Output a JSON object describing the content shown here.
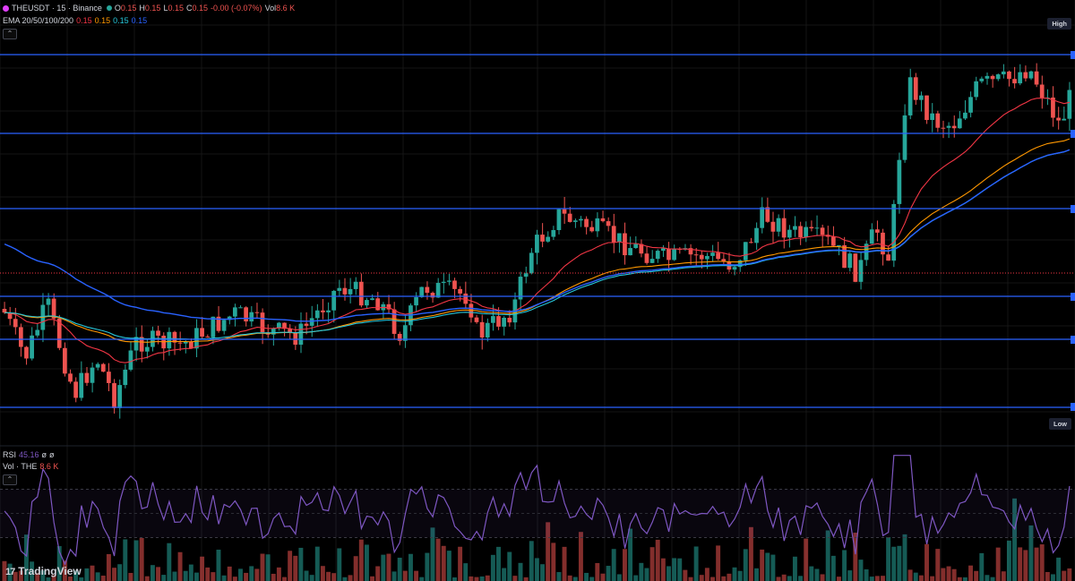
{
  "symbol": {
    "name": "THEUSDT",
    "interval": "15",
    "exchange": "Binance",
    "title_full": "THEUSDT · 15 · Binance"
  },
  "ohlc": {
    "o_label": "O",
    "o": "0.15",
    "h_label": "H",
    "h": "0.15",
    "l_label": "L",
    "l": "0.15",
    "c_label": "C",
    "c": "0.15",
    "change": "-0.00 (-0.07%)",
    "vol_label": "Vol",
    "vol": "8.6 K"
  },
  "ema_legend": {
    "label": "EMA 20/50/100/200",
    "v1": "0.15",
    "v2": "0.15",
    "v3": "0.15",
    "v4": "0.15",
    "colors": [
      "#f23645",
      "#ff9800",
      "#26c6da",
      "#2962ff"
    ]
  },
  "rsi_legend": {
    "label": "RSI",
    "value": "45.16",
    "na1": "ø",
    "na2": "ø",
    "color": "#7e57c2"
  },
  "vol_legend": {
    "label": "Vol · THE",
    "value": "8.6 K"
  },
  "badges": {
    "high": "High",
    "low": "Low"
  },
  "branding": {
    "text": "TradingView"
  },
  "icons": {
    "symbol": "symbol-logo-icon",
    "collapse": "chevron-up-icon",
    "logo": "tradingview-logo-icon"
  },
  "colors": {
    "background": "#000000",
    "grid": "#151515",
    "up": "#26a69a",
    "down": "#ef5350",
    "hline": "#2962ff",
    "price_line": "#f23645",
    "rsi": "#7e57c2"
  },
  "chart_data": {
    "type": "candlestick",
    "description_levels": "horizontal support/resistance lines drawn by user",
    "candle_count": 195,
    "series": [
      {
        "name": "EMA 20"
      },
      {
        "name": "EMA 50"
      },
      {
        "name": "EMA 100"
      },
      {
        "name": "EMA 200"
      }
    ],
    "rsi": {
      "last": 45.16,
      "range": [
        0,
        100
      ],
      "bands": [
        30,
        70
      ]
    },
    "volume": {
      "last": "8.6 K"
    },
    "grid": true,
    "legend_placement": "top-left"
  }
}
